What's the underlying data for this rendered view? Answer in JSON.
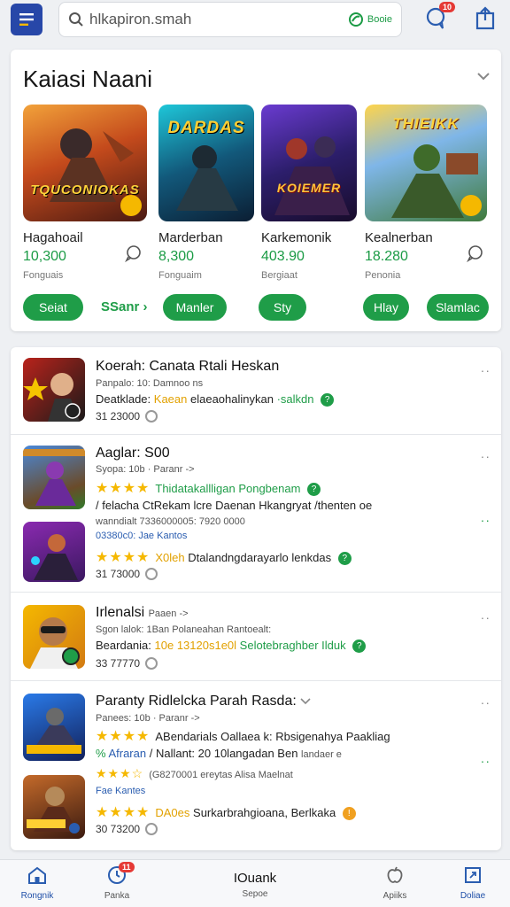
{
  "header": {
    "search_text": "hlkapiron.smah",
    "books_label": "Booie",
    "chat_badge": "10"
  },
  "featured": {
    "title": "Kaiasi Naani",
    "games": [
      {
        "art_text": "TQUCONIOKAS",
        "name": "Hagahoail",
        "value": "10,300",
        "sub": "Fonguais"
      },
      {
        "art_text": "DARDAS",
        "name": "Marderban",
        "value": "8,300",
        "sub": "Fonguaim"
      },
      {
        "art_text": "KOIEMER",
        "name": "Karkemonik",
        "value": "403.90",
        "sub": "Bergiaat"
      },
      {
        "art_text": "THIEIKK",
        "name": "Kealnerban",
        "value": "18.280",
        "sub": "Penonia"
      }
    ],
    "buttons": [
      "Seiat",
      "SSanr",
      "Manler",
      "Sty",
      "Hlay",
      "Slamlac"
    ]
  },
  "list": {
    "items": [
      {
        "title": "Koerah: Canata Rtali Heskan",
        "meta": "Panpalo: 10: Damnoo ns",
        "desc_a": "Deatklade:",
        "desc_b": "Kaean",
        "desc_c": "elaeaohalinykan",
        "desc_d": "·salkdn",
        "num": "31 23000"
      },
      {
        "title": "Aaglar: S00",
        "meta": "Syopa: 10b · Paranr ->",
        "rating_text": "Thidatakallligan Pongbenam",
        "line3": "/ felacha CtRekam lcre Daenan Hkangryat /thenten oe",
        "line4": "wanndialt  7336000005:  7920  0000",
        "line5": "03380c0:   Jae Kantos",
        "sub_rating_a": "X0leh",
        "sub_rating_b": "Dtalandngdarayarlo lenkdas",
        "num": "31 73000"
      },
      {
        "title": "Irlenalsi",
        "title_suffix": "Paaen ->",
        "meta": "Sgon lalok: 1Ban Polaneahan Rantoealt:",
        "desc_a": "Beardania:",
        "desc_b": "10e 13120s1e0l",
        "desc_c": "Selotebraghber Ilduk",
        "num": "33 77770"
      },
      {
        "title": "Paranty Ridlelcka Parah Rasda:",
        "meta": "Panees: 10b · Paranr ->",
        "rating_text": "ABendarials Oallaea k: Rbsigenahya Paakliag",
        "line3_a": "Afraran",
        "line3_b": "/ Nallant: 20 10langadan Ben",
        "line3_c": "landaer e",
        "line4": "(G8270001 ereytas Alisa Maelnat",
        "line5": "Fae Kantes",
        "sub_rating_a": "DA0es",
        "sub_rating_b": "Surkarbrahgioana, Berlkaka",
        "num": "30 73200"
      }
    ]
  },
  "bottom_nav": {
    "items": [
      {
        "label": "Rongnik"
      },
      {
        "label": "Panka",
        "badge": "11"
      },
      {
        "label": "Sepoe",
        "title": "IOuank"
      },
      {
        "label": "Apiiks"
      },
      {
        "label": "Doliae"
      }
    ]
  },
  "colors": {
    "accent_green": "#1f9d48",
    "brand_blue": "#2747a8",
    "star": "#f5b800"
  }
}
